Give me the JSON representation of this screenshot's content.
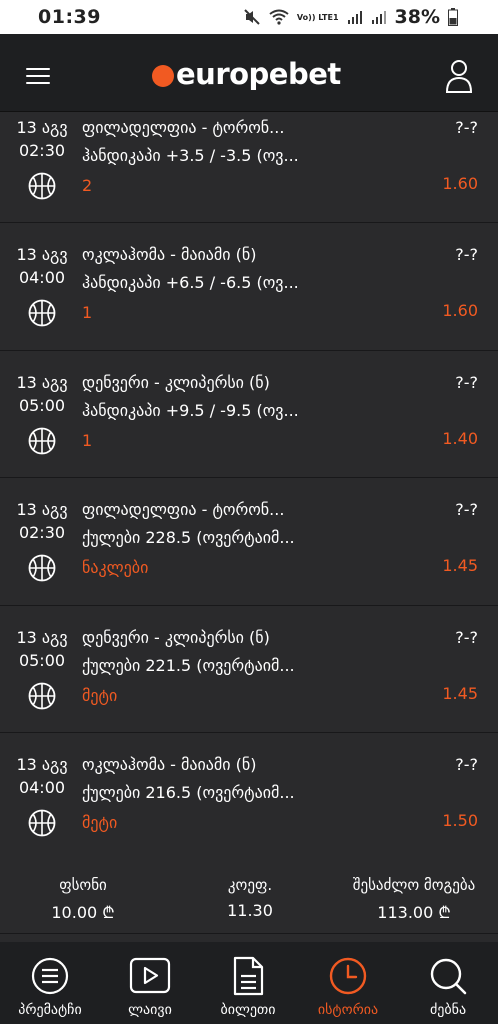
{
  "status_bar": {
    "time": "01:39",
    "network": "Vo)) LTE1",
    "battery": "38%"
  },
  "header": {
    "logo_text": "europebet",
    "icons": [
      "menu-icon",
      "user-icon"
    ],
    "brand_color": "#f15a22"
  },
  "bets": [
    {
      "date": "13 აგვ",
      "time": "02:30",
      "match": "ფილადელფია - ტორონ...",
      "market": "ჰანდიკაპი +3.5 / -3.5 (ოვ...",
      "pick": "2",
      "score": "?-?",
      "odds": "1.60",
      "sport_icon": "basketball-icon"
    },
    {
      "date": "13 აგვ",
      "time": "04:00",
      "match": "ოკლაჰომა - მაიამი (ნ)",
      "market": "ჰანდიკაპი +6.5 / -6.5 (ოვ...",
      "pick": "1",
      "score": "?-?",
      "odds": "1.60",
      "sport_icon": "basketball-icon"
    },
    {
      "date": "13 აგვ",
      "time": "05:00",
      "match": "დენვერი - კლიპერსი (ნ)",
      "market": "ჰანდიკაპი +9.5 / -9.5 (ოვ...",
      "pick": "1",
      "score": "?-?",
      "odds": "1.40",
      "sport_icon": "basketball-icon"
    },
    {
      "date": "13 აგვ",
      "time": "02:30",
      "match": "ფილადელფია - ტორონ...",
      "market": "ქულები 228.5 (ოვერტაიმ...",
      "pick": "ნაკლები",
      "score": "?-?",
      "odds": "1.45",
      "sport_icon": "basketball-icon"
    },
    {
      "date": "13 აგვ",
      "time": "05:00",
      "match": "დენვერი - კლიპერსი (ნ)",
      "market": "ქულები 221.5 (ოვერტაიმ...",
      "pick": "მეტი",
      "score": "?-?",
      "odds": "1.45",
      "sport_icon": "basketball-icon"
    },
    {
      "date": "13 აგვ",
      "time": "04:00",
      "match": "ოკლაჰომა - მაიამი (ნ)",
      "market": "ქულები 216.5 (ოვერტაიმ...",
      "pick": "მეტი",
      "score": "?-?",
      "odds": "1.50",
      "sport_icon": "basketball-icon"
    }
  ],
  "summary": {
    "stake_label": "ფსონი",
    "stake_value": "10.00 ₾",
    "odds_label": "კოეფ.",
    "odds_value": "11.30",
    "win_label": "შესაძლო მოგება",
    "win_value": "113.00 ₾"
  },
  "nav": [
    {
      "label": "პრემატჩი",
      "icon": "prematch-list-icon",
      "active": false
    },
    {
      "label": "ლაივი",
      "icon": "live-play-icon",
      "active": false
    },
    {
      "label": "ბილეთი",
      "icon": "ticket-document-icon",
      "active": false
    },
    {
      "label": "ისტორია",
      "icon": "history-clock-icon",
      "active": true
    },
    {
      "label": "ძებნა",
      "icon": "search-icon",
      "active": false
    }
  ]
}
